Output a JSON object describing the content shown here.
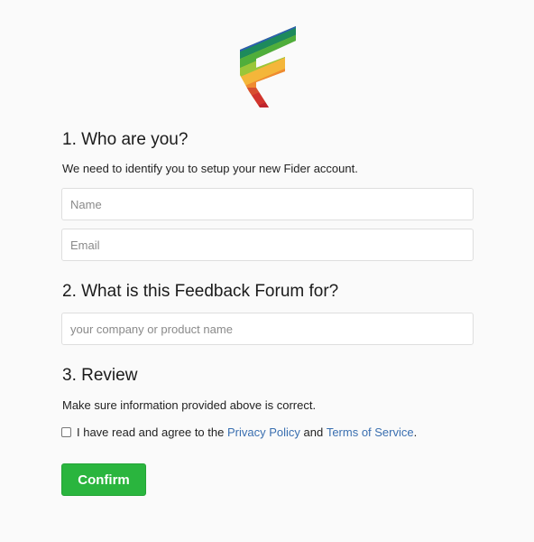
{
  "logo": {
    "icon": "fider-logo-icon"
  },
  "section1": {
    "title": "1. Who are you?",
    "description": "We need to identify you to setup your new Fider account.",
    "name_placeholder": "Name",
    "name_value": "",
    "email_placeholder": "Email",
    "email_value": ""
  },
  "section2": {
    "title": "2. What is this Feedback Forum for?",
    "forum_placeholder": "your company or product name",
    "forum_value": ""
  },
  "section3": {
    "title": "3. Review",
    "description": "Make sure information provided above is correct.",
    "agree_prefix": "I have read and agree to the ",
    "privacy_link": "Privacy Policy",
    "agree_and": " and ",
    "terms_link": "Terms of Service",
    "agree_suffix": ".",
    "agree_checked": false
  },
  "confirm_label": "Confirm",
  "colors": {
    "accent": "#2ab53e",
    "link": "#3a6fb0",
    "background": "#fafafa"
  }
}
